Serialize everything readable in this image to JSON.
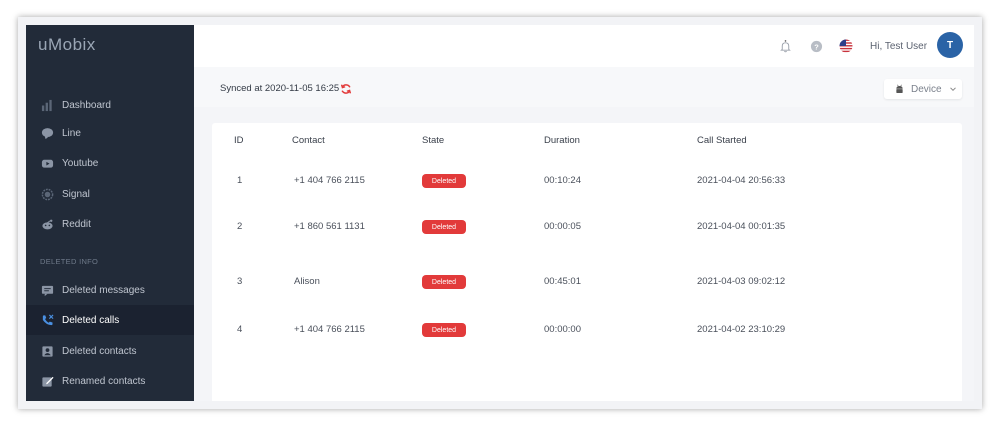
{
  "app": {
    "logo": "uMobix"
  },
  "sidebar": {
    "items": [
      {
        "label": "Dashboard",
        "icon": "bar-chart-icon"
      },
      {
        "label": "Line",
        "icon": "line-chat-icon"
      },
      {
        "label": "Youtube",
        "icon": "youtube-icon"
      },
      {
        "label": "Signal",
        "icon": "signal-icon"
      },
      {
        "label": "Reddit",
        "icon": "reddit-icon"
      }
    ],
    "section_label": "DELETED INFO",
    "deleted_items": [
      {
        "label": "Deleted messages",
        "icon": "message-icon"
      },
      {
        "label": "Deleted calls",
        "icon": "phone-icon",
        "active": true
      },
      {
        "label": "Deleted contacts",
        "icon": "contact-icon"
      },
      {
        "label": "Renamed contacts",
        "icon": "edit-icon"
      }
    ]
  },
  "header": {
    "greeting": "Hi, Test User",
    "avatar_initial": "T",
    "icons": [
      "bell-icon",
      "help-icon",
      "us-flag-icon"
    ]
  },
  "syncbar": {
    "text": "Synced at 2020-11-05 16:25",
    "device_label": "Device",
    "refresh_color": "#e23a3a"
  },
  "table": {
    "columns": [
      "ID",
      "Contact",
      "State",
      "Duration",
      "Call Started"
    ],
    "rows": [
      {
        "id": "1",
        "contact": "+1 404 766 2115",
        "state": "Deleted",
        "duration": "00:10:24",
        "started": "2021-04-04 20:56:33"
      },
      {
        "id": "2",
        "contact": "+1 860 561 1131",
        "state": "Deleted",
        "duration": "00:00:05",
        "started": "2021-04-04 00:01:35"
      },
      {
        "id": "3",
        "contact": "Alison",
        "state": "Deleted",
        "duration": "00:45:01",
        "started": "2021-04-03 09:02:12"
      },
      {
        "id": "4",
        "contact": "+1 404 766 2115",
        "state": "Deleted",
        "duration": "00:00:00",
        "started": "2021-04-02 23:10:29"
      }
    ]
  },
  "colors": {
    "sidebar": "#222b39",
    "badge": "#e23a3a",
    "avatar": "#2a63a6"
  }
}
